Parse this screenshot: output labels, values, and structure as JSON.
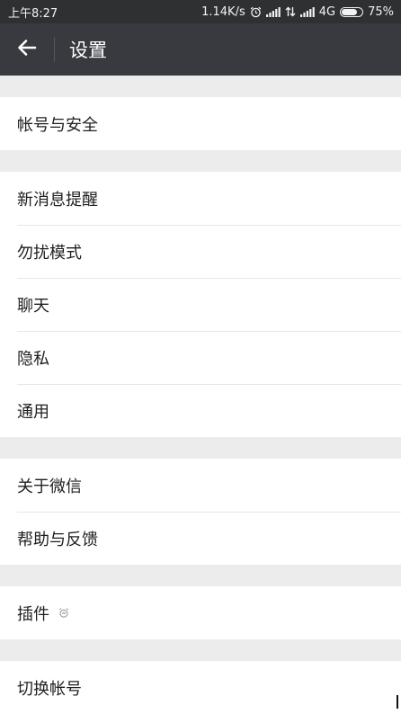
{
  "status_bar": {
    "time": "上午8:27",
    "net_speed": "1.14K/s",
    "alarm_icon": "alarm-clock-icon",
    "signal_icon": "signal-bars-icon",
    "data_icon": "data-transfer-icon",
    "network_type": "4G",
    "battery_level": 0.75,
    "battery_text": "75%"
  },
  "app_bar": {
    "back_icon": "arrow-left-icon",
    "title": "设置"
  },
  "settings": {
    "account_security": "帐号与安全",
    "notifications": "新消息提醒",
    "do_not_disturb": "勿扰模式",
    "chat": "聊天",
    "privacy": "隐私",
    "general": "通用",
    "about": "关于微信",
    "help_feedback": "帮助与反馈",
    "plugins": "插件",
    "plugins_icon": "plugin-alarm-icon",
    "switch_account": "切换帐号"
  },
  "colors": {
    "app_bar_bg": "#393a3f",
    "status_bar_bg": "#2f3032",
    "page_bg": "#ececec",
    "item_bg": "#ffffff"
  }
}
